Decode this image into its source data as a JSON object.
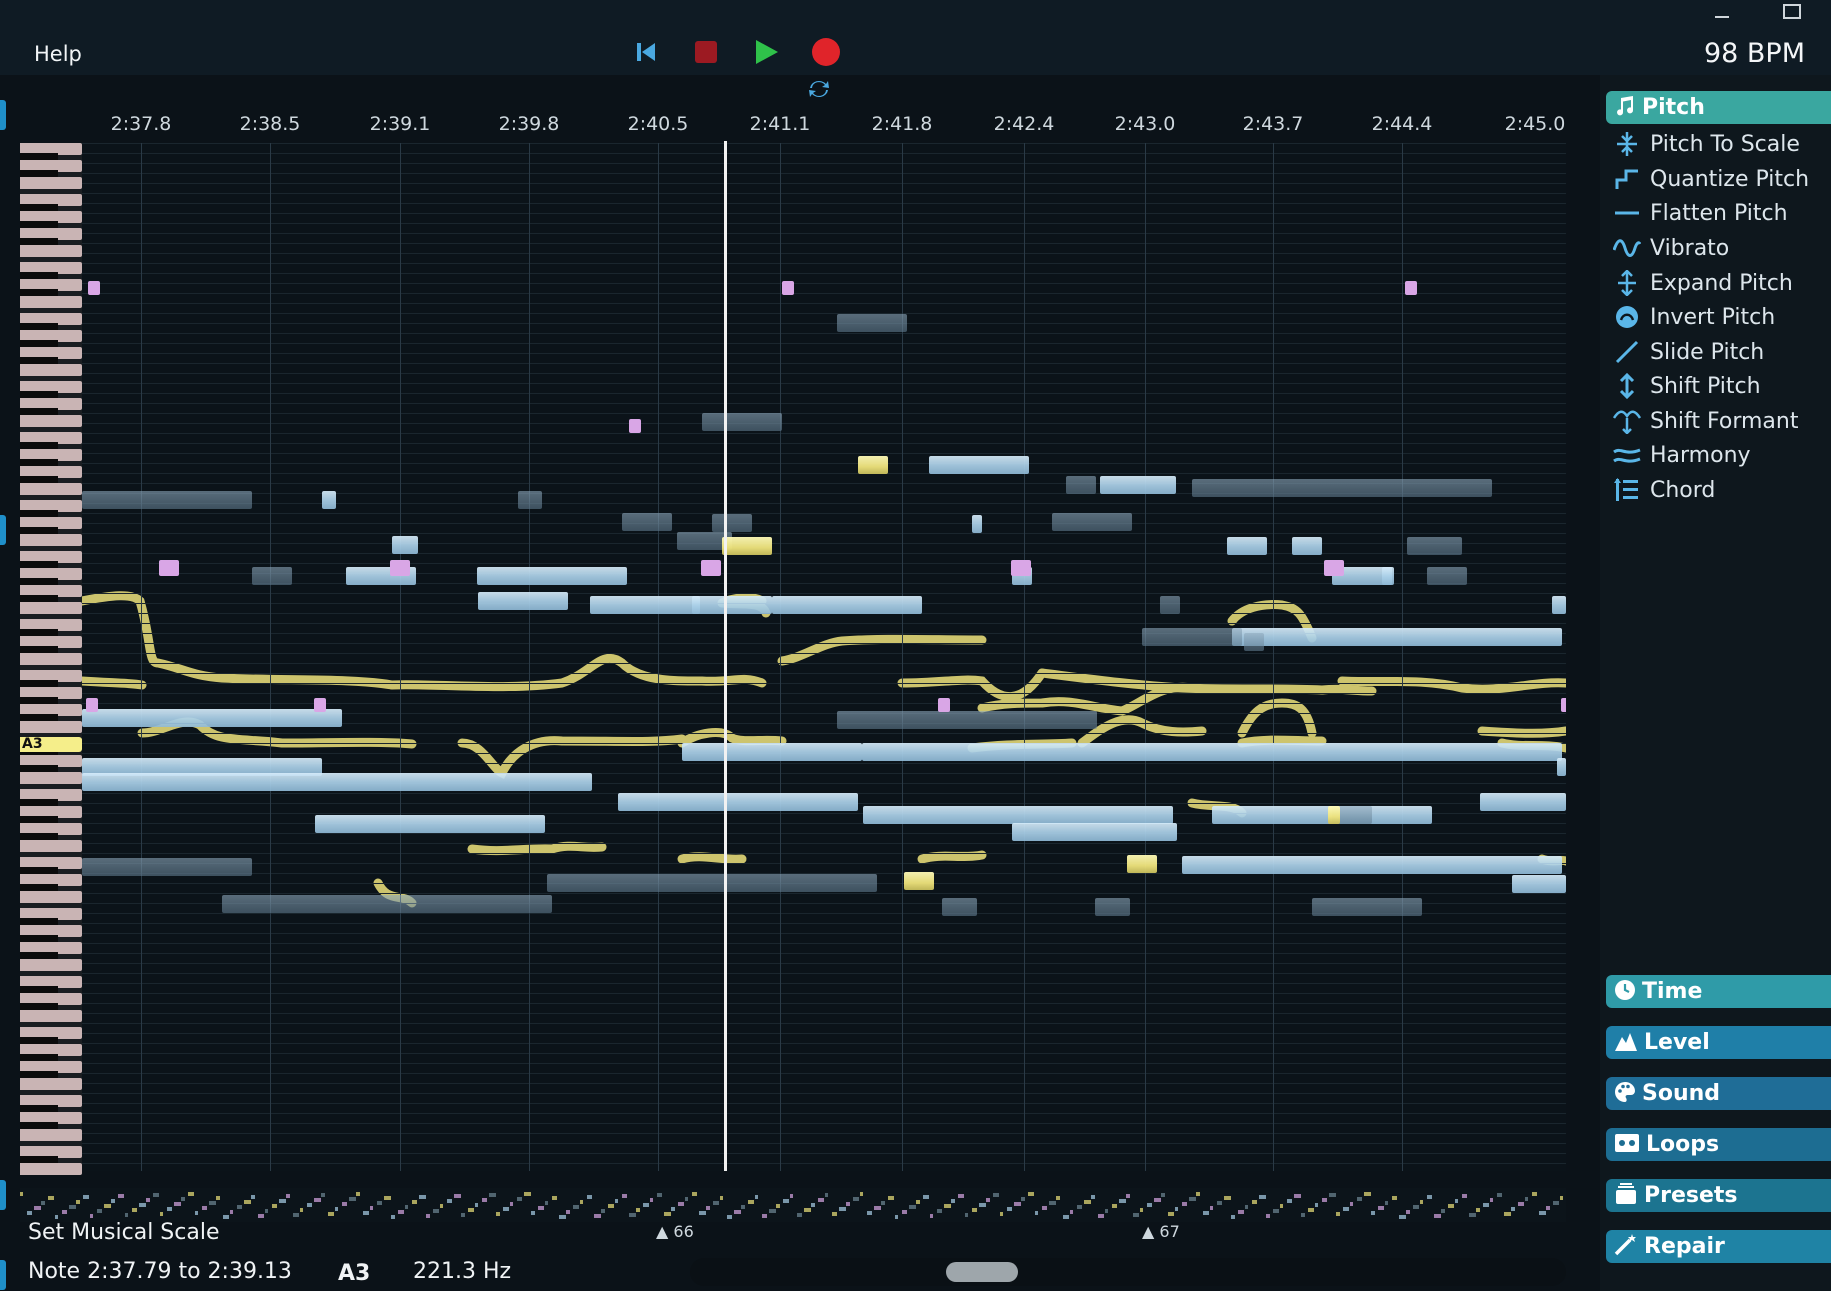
{
  "menu": {
    "help": "Help"
  },
  "transport": {
    "rewind": "rewind-icon",
    "stop": "stop-icon",
    "play": "play-icon",
    "record": "record-icon",
    "loop": "loop-icon"
  },
  "tempo": {
    "bpm": "98 BPM"
  },
  "ruler": {
    "ticks": [
      "2:37.8",
      "2:38.5",
      "2:39.1",
      "2:39.8",
      "2:40.5",
      "2:41.1",
      "2:41.8",
      "2:42.4",
      "2:43.0",
      "2:43.7",
      "2:44.4",
      "2:45.0"
    ]
  },
  "piano": {
    "highlighted_key": "A3"
  },
  "tools": {
    "pitch": {
      "title": "Pitch",
      "items": [
        {
          "label": "Pitch To Scale",
          "icon": "pitch-to-scale-icon"
        },
        {
          "label": "Quantize Pitch",
          "icon": "quantize-pitch-icon"
        },
        {
          "label": "Flatten Pitch",
          "icon": "flatten-pitch-icon"
        },
        {
          "label": "Vibrato",
          "icon": "vibrato-icon"
        },
        {
          "label": "Expand Pitch",
          "icon": "expand-pitch-icon"
        },
        {
          "label": "Invert Pitch",
          "icon": "invert-pitch-icon"
        },
        {
          "label": "Slide Pitch",
          "icon": "slide-pitch-icon"
        },
        {
          "label": "Shift Pitch",
          "icon": "shift-pitch-icon"
        },
        {
          "label": "Shift Formant",
          "icon": "shift-formant-icon"
        },
        {
          "label": "Harmony",
          "icon": "harmony-icon"
        },
        {
          "label": "Chord",
          "icon": "chord-icon"
        }
      ]
    },
    "time": "Time",
    "level": "Level",
    "sound": "Sound",
    "loops": "Loops",
    "presets": "Presets",
    "repair": "Repair"
  },
  "markers": {
    "bar_a": "66",
    "bar_b": "67"
  },
  "status": {
    "action": "Set Musical Scale",
    "note_range": "Note 2:37.79 to 2:39.13",
    "pitch": "A3",
    "frequency": "221.3 Hz"
  },
  "colors": {
    "accent_teal": "#3aa7a0",
    "note_blue": "#a9cfe8",
    "note_yellow": "#efe47c",
    "note_pink": "#d9a6e6",
    "record_red": "#e0242a",
    "play_green": "#2fc24a"
  }
}
